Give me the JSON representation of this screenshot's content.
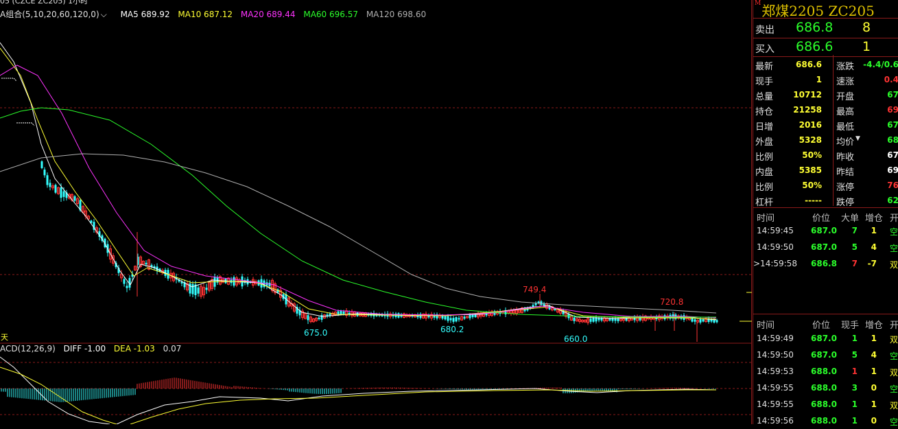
{
  "chart_header": {
    "title_partial": "05  (CZCE  ZC205)    1小时",
    "ma_group": "A组合(5,10,20,60,120,0)",
    "ma5": "MA5 689.92",
    "ma10": "MA10 687.12",
    "ma20": "MA20 689.44",
    "ma60": "MA60 696.57",
    "ma120": "MA120 698.60"
  },
  "colors": {
    "ma5": "#ffffff",
    "ma10": "#ffff33",
    "ma20": "#ff33ff",
    "ma60": "#2bff2b",
    "ma120": "#b0b0b0",
    "up": "#ff3333",
    "down": "#33ffff",
    "grid": "#8b1a1a",
    "label_red": "#ff3333",
    "label_cyan": "#33ffff"
  },
  "price_labels": {
    "high1": "749.4",
    "high2": "720.8",
    "low1": "675.0",
    "low2": "680.2",
    "low3": "660.0"
  },
  "period_marker": "天",
  "macd_header": {
    "name": "ACD(12,26,9)",
    "diff": "DIFF -1.00",
    "dea": "DEA -1.03",
    "macd": "0.07"
  },
  "quote": {
    "title": "郑煤2205  ZC205",
    "marker": "M",
    "sell_label": "卖出",
    "sell_price": "686.8",
    "sell_vol": "8",
    "buy_label": "买入",
    "buy_price": "686.6",
    "buy_vol": "1",
    "rows": [
      {
        "k1": "最新",
        "v1": "686.6",
        "k2": "涨跌",
        "v2": "-4.4/0.6",
        "c2": "#2bff2b"
      },
      {
        "k1": "现手",
        "v1": "1",
        "k2": "速涨",
        "v2": "0.4",
        "c2": "#ff3333"
      },
      {
        "k1": "总量",
        "v1": "10712",
        "k2": "开盘",
        "v2": "67",
        "c2": "#2bff2b"
      },
      {
        "k1": "持仓",
        "v1": "21258",
        "k2": "最高",
        "v2": "69",
        "c2": "#ff3333"
      },
      {
        "k1": "日增",
        "v1": "2016",
        "k2": "最低",
        "v2": "67",
        "c2": "#2bff2b"
      },
      {
        "k1": "外盘",
        "v1": "5328",
        "k2": "均价",
        "v2": "68",
        "c2": "#2bff2b"
      },
      {
        "k1": "比例",
        "v1": "50%",
        "k2": "昨收",
        "v2": "67",
        "c2": "#ffffff"
      },
      {
        "k1": "内盘",
        "v1": "5385",
        "k2": "昨结",
        "v2": "69",
        "c2": "#ffffff"
      },
      {
        "k1": "比例",
        "v1": "50%",
        "k2": "涨停",
        "v2": "76",
        "c2": "#ff3333"
      },
      {
        "k1": "杠杆",
        "v1": "-----",
        "k2": "跌停",
        "v2": "62",
        "c2": "#2bff2b"
      }
    ]
  },
  "big_orders": {
    "headers": [
      "时间",
      "价位",
      "大单",
      "增仓",
      "开"
    ],
    "rows": [
      {
        "time": "14:59:45",
        "price": "687.0",
        "vol": "7",
        "oi": "1",
        "type": "空",
        "vc": "#2bff2b",
        "oc": "#ffff33",
        "tc": "#2bff2b"
      },
      {
        "time": "14:59:50",
        "price": "687.0",
        "vol": "5",
        "oi": "4",
        "type": "空",
        "vc": "#2bff2b",
        "oc": "#ffff33",
        "tc": "#2bff2b"
      },
      {
        "time": ">14:59:58",
        "price": "686.8",
        "vol": "7",
        "oi": "-7",
        "type": "双",
        "vc": "#ff3333",
        "oc": "#ffff33",
        "tc": "#ffff33"
      }
    ]
  },
  "ticks": {
    "headers": [
      "时间",
      "价位",
      "现手",
      "增仓",
      "开"
    ],
    "rows": [
      {
        "time": "14:59:49",
        "price": "687.0",
        "vol": "1",
        "oi": "1",
        "type": "双",
        "vc": "#2bff2b",
        "tc": "#ffff33"
      },
      {
        "time": "14:59:50",
        "price": "687.0",
        "vol": "5",
        "oi": "4",
        "type": "空",
        "vc": "#2bff2b",
        "tc": "#2bff2b"
      },
      {
        "time": "14:59:53",
        "price": "688.0",
        "vol": "1",
        "oi": "1",
        "type": "双",
        "vc": "#ff3333",
        "tc": "#ffff33"
      },
      {
        "time": "14:59:55",
        "price": "688.0",
        "vol": "3",
        "oi": "0",
        "type": "空",
        "vc": "#2bff2b",
        "tc": "#2bff2b"
      },
      {
        "time": "14:59:55",
        "price": "688.0",
        "vol": "1",
        "oi": "1",
        "type": "双",
        "vc": "#2bff2b",
        "tc": "#ffff33"
      },
      {
        "time": "14:59:56",
        "price": "688.0",
        "vol": "1",
        "oi": "0",
        "type": "空",
        "vc": "#2bff2b",
        "tc": "#2bff2b"
      }
    ]
  }
}
